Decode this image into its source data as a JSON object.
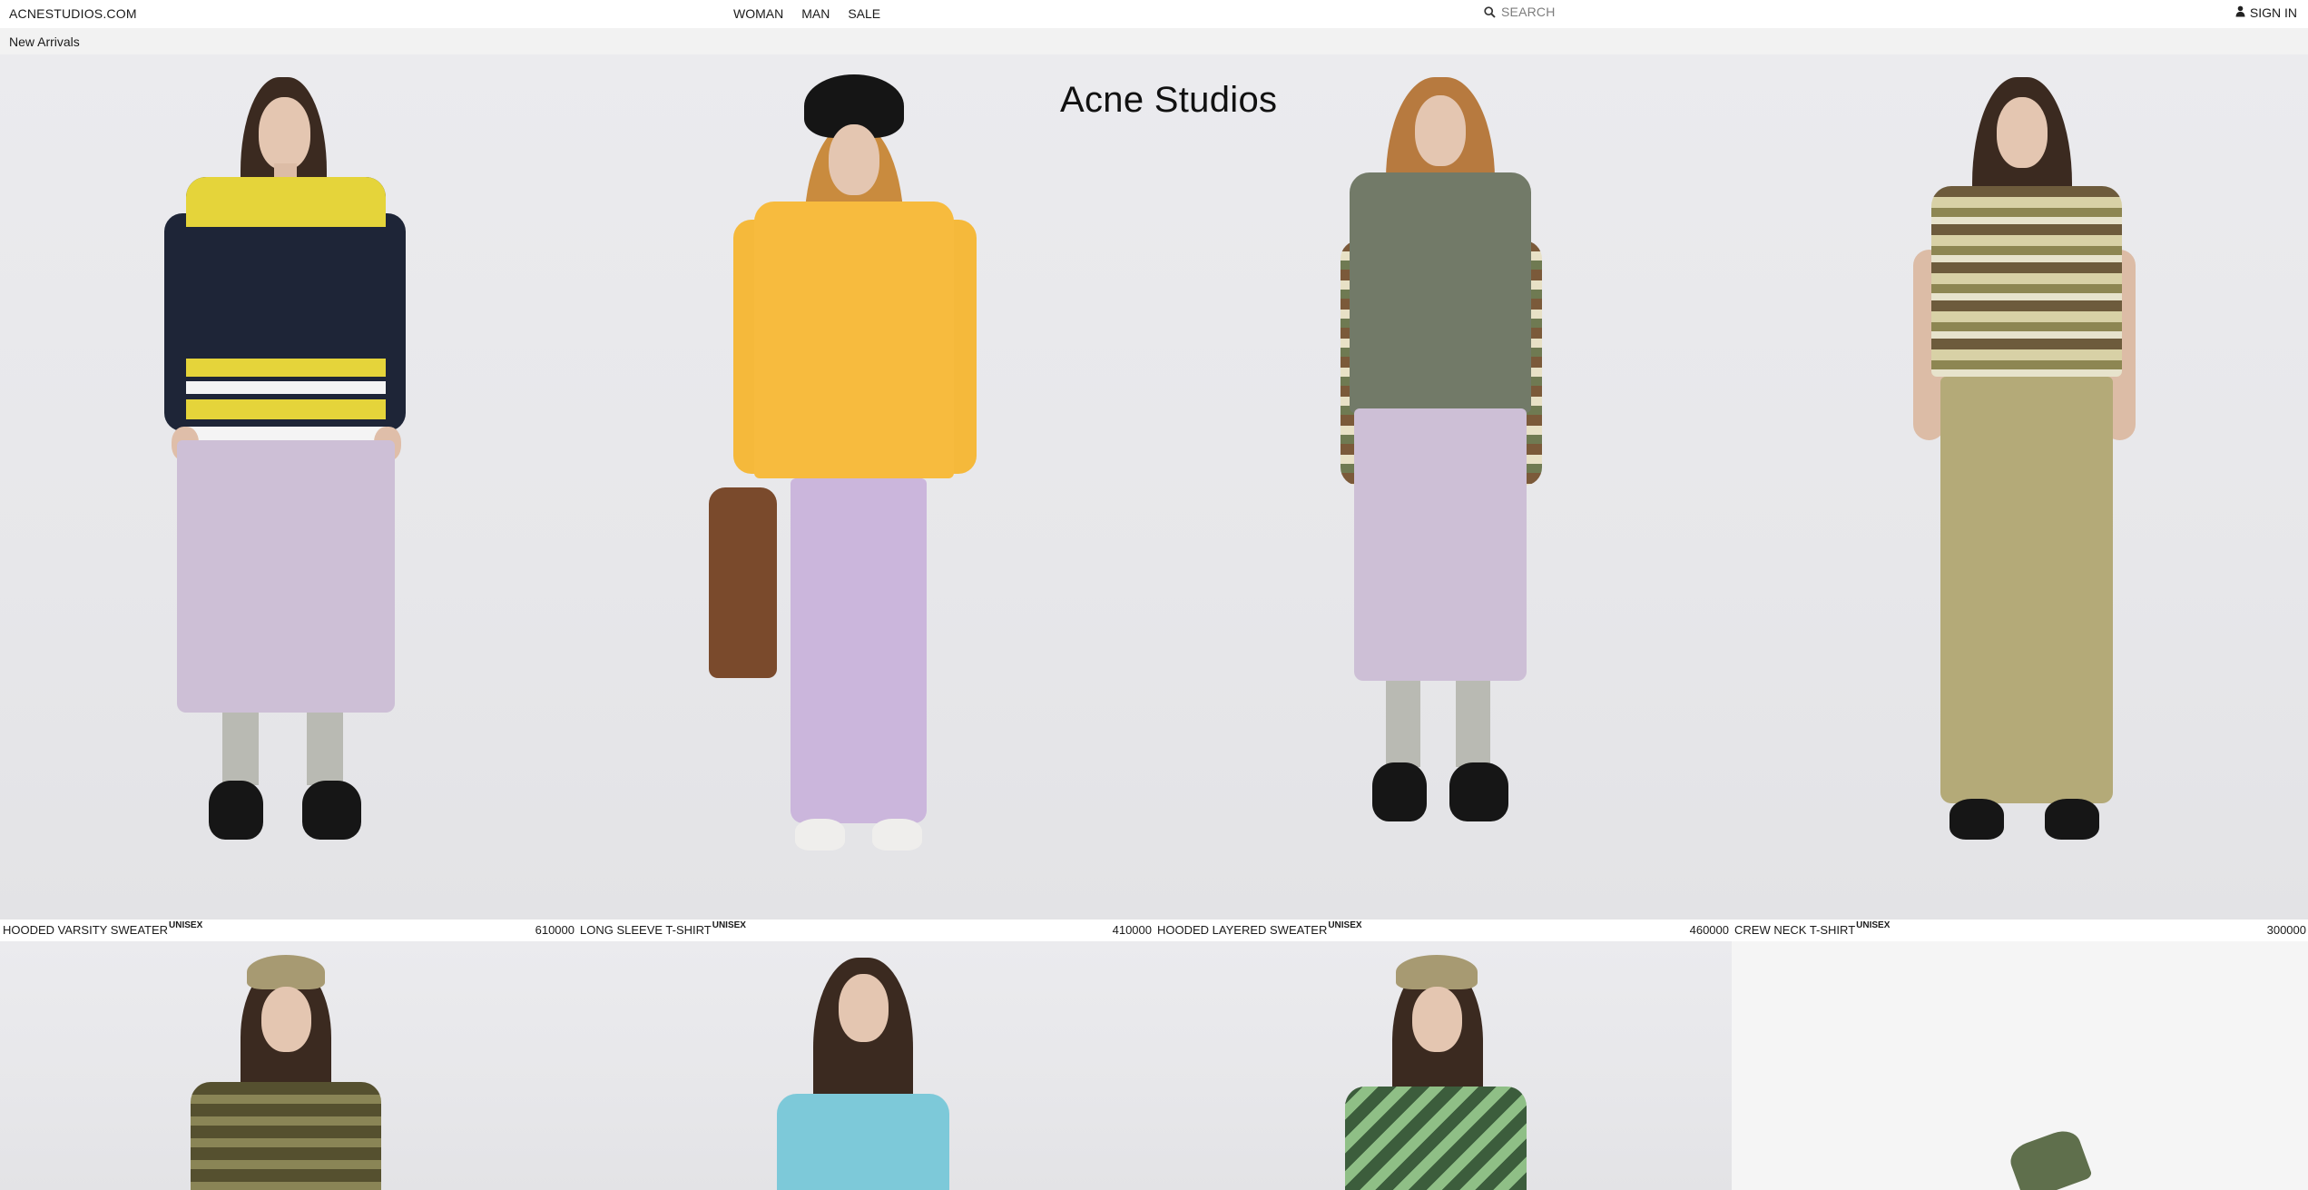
{
  "header": {
    "site_name": "ACNESTUDIOS.COM",
    "nav": [
      "WOMAN",
      "MAN",
      "SALE"
    ],
    "search_placeholder": "SEARCH",
    "sign_in": "SIGN IN"
  },
  "breadcrumb": "New Arrivals",
  "brand_logo": "Acne Studios",
  "products": [
    {
      "title": "HOODED VARSITY SWEATER",
      "tag": "UNISEX",
      "price": "610000"
    },
    {
      "title": "LONG SLEEVE T-SHIRT",
      "tag": "UNISEX",
      "price": "410000"
    },
    {
      "title": "HOODED LAYERED SWEATER",
      "tag": "UNISEX",
      "price": "460000"
    },
    {
      "title": "CREW NECK T-SHIRT",
      "tag": "UNISEX",
      "price": "300000"
    }
  ],
  "colors": {
    "accent": "#111111",
    "background": "#ffffff",
    "subbar": "#f2f2f2",
    "image_bg": "#e9e9ec"
  },
  "icons": [
    "search-icon",
    "user-icon"
  ]
}
